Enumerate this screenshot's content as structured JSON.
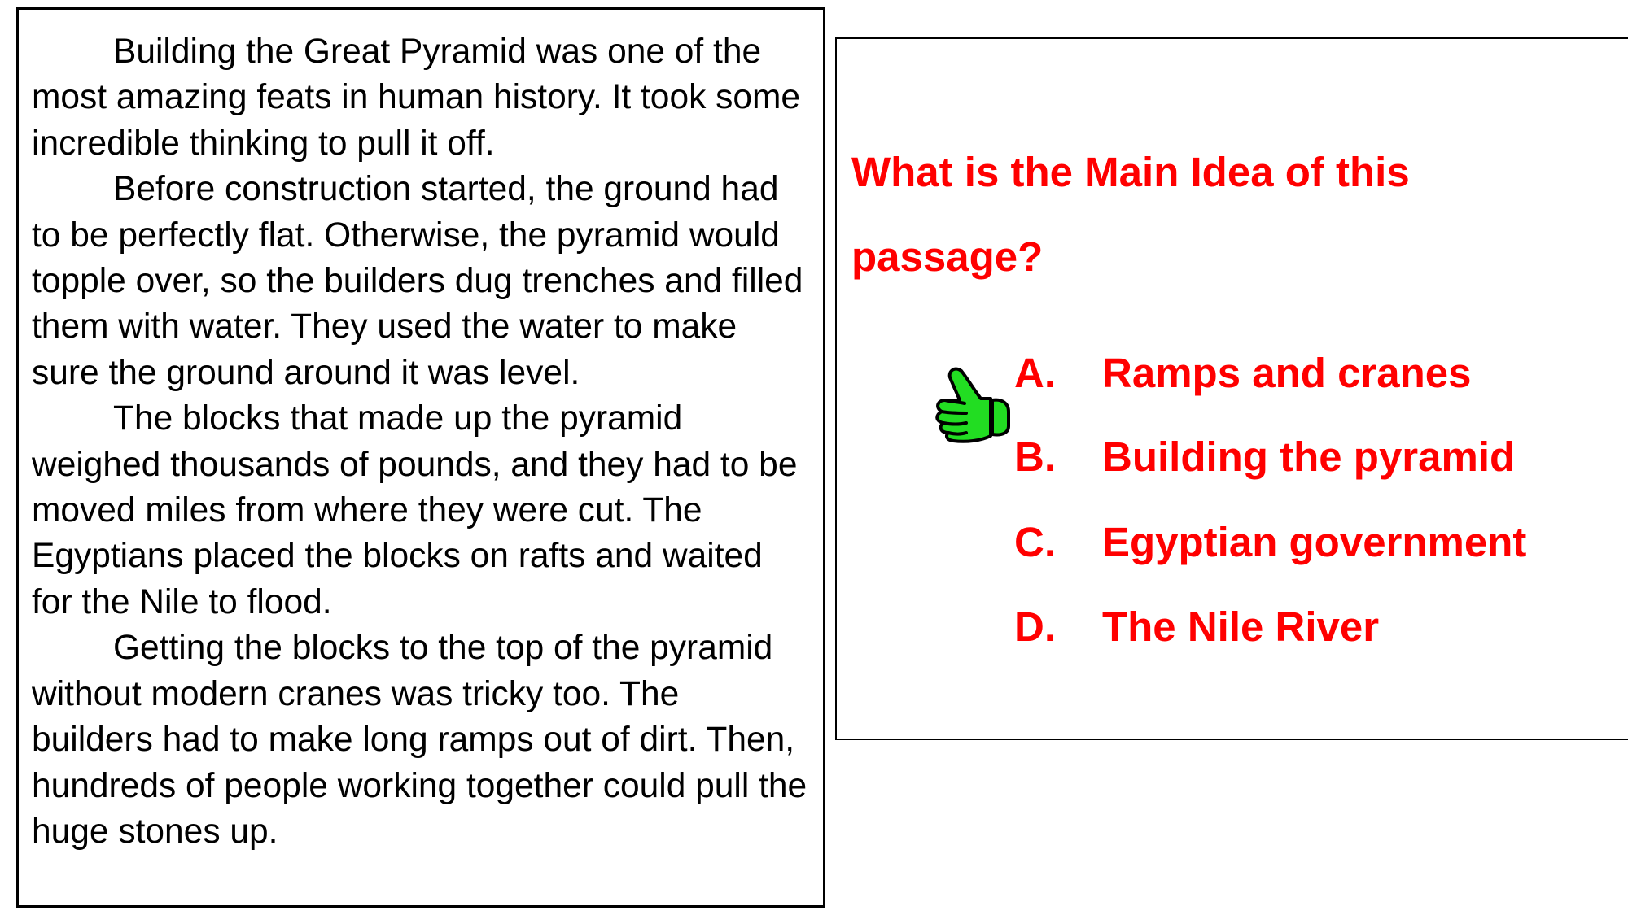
{
  "passage": {
    "paragraphs": [
      "Building the Great Pyramid was one of the most amazing feats in human history.  It took some incredible thinking to pull it off.",
      "Before construction started, the ground had to be perfectly flat.  Otherwise, the pyramid would topple over, so the builders dug trenches and filled them with water. They used the water to make sure the ground around it was level.",
      "The blocks that made up the pyramid weighed thousands of pounds, and they had to be moved miles from where they were cut. The Egyptians placed the blocks on rafts and waited for the Nile to flood.",
      "Getting the blocks to the top of the pyramid without modern cranes was tricky too.  The builders had to make long ramps out of dirt.  Then, hundreds of people working together could pull the huge stones up."
    ]
  },
  "question": {
    "text": "What is the Main Idea of this passage?",
    "options": [
      {
        "letter": "A.",
        "text": "Ramps and cranes"
      },
      {
        "letter": "B.",
        "text": "Building the pyramid"
      },
      {
        "letter": "C.",
        "text": "Egyptian government"
      },
      {
        "letter": "D.",
        "text": "The Nile River"
      }
    ],
    "selected_option": "B.",
    "selection_icon": "thumbs-up-icon"
  },
  "colors": {
    "question_text": "#ff0000",
    "thumbs_fill": "#22dd22",
    "border": "#000000"
  }
}
